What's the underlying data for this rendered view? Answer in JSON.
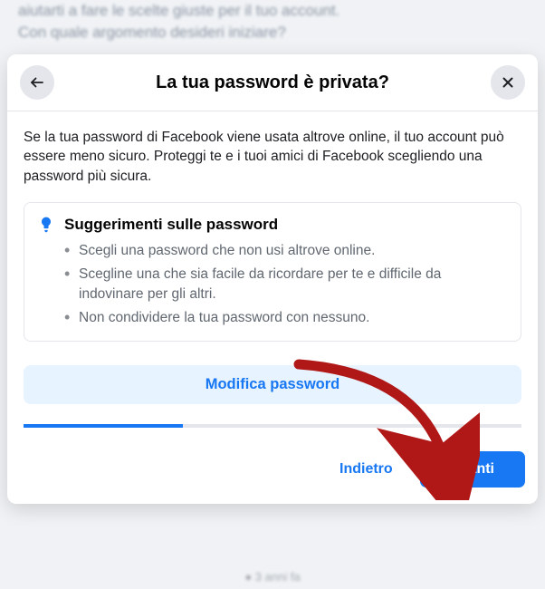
{
  "background": {
    "line1": "aiutarti a fare le scelte giuste per il tuo account.",
    "line2": "Con quale argomento desideri iniziare?",
    "timestamp": "3 anni fa"
  },
  "modal": {
    "title": "La tua password è privata?",
    "description": "Se la tua password di Facebook viene usata altrove online, il tuo account può essere meno sicuro. Proteggi te e i tuoi amici di Facebook scegliendo una password più sicura.",
    "tips": {
      "title": "Suggerimenti sulle password",
      "items": [
        "Scegli una password che non usi altrove online.",
        "Scegline una che sia facile da ricordare per te e difficile da indovinare per gli altri.",
        "Non condividere la tua password con nessuno."
      ]
    },
    "change_password_label": "Modifica password",
    "back_label": "Indietro",
    "next_label": "Avanti"
  }
}
